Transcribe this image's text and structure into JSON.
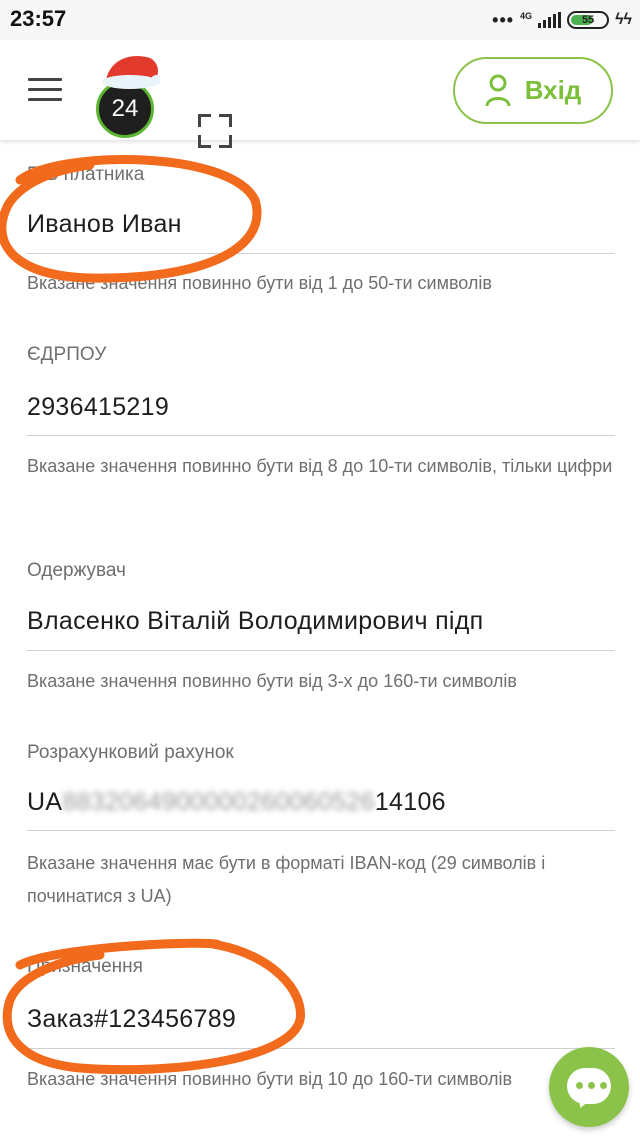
{
  "status": {
    "time": "23:57",
    "network": "4G",
    "battery": "55"
  },
  "header": {
    "logo_text": "24",
    "login_label": "Вхід",
    "accent_color": "#8bc34a"
  },
  "fields": [
    {
      "label": "ПІБ платника",
      "value": "Иванов Иван",
      "hint": "Вказане значення повинно бути від 1 до 50-ти символів"
    },
    {
      "label": "ЄДРПОУ",
      "value": "2936415219",
      "hint": "Вказане значення повинно бути від 8 до 10-ти символів, тільки цифри"
    },
    {
      "label": "Одержувач",
      "value": "Власенко Віталій Володимирович підп",
      "hint": "Вказане значення повинно бути від 3-х до 160-ти символів"
    },
    {
      "label": "Розрахунковий рахунок",
      "value_prefix": "UA",
      "value_masked": "8832064900000260060526",
      "value_suffix": "14106",
      "hint": "Вказане значення має бути в форматі IBAN-код (29 символів і починатися з UA)"
    },
    {
      "label": "Призначення",
      "value": "Заказ#123456789",
      "hint": "Вказане значення повинно бути від 10 до 160-ти символів"
    }
  ],
  "icons": {
    "menu": "hamburger-menu-icon",
    "fullscreen": "fullscreen-icon",
    "user": "user-icon",
    "chat": "chat-icon"
  }
}
